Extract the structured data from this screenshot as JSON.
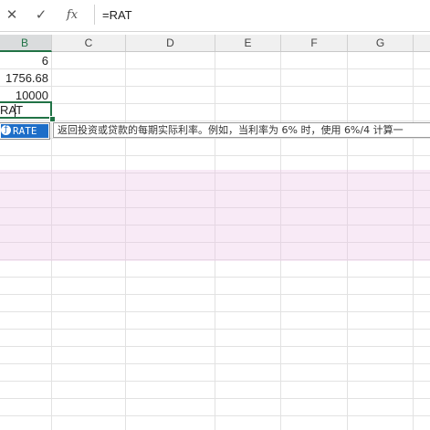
{
  "formula_bar": {
    "cancel_icon": "✕",
    "enter_icon": "✓",
    "fx_label": "fx",
    "formula": "=RAT"
  },
  "columns": [
    "B",
    "C",
    "D",
    "E",
    "F",
    "G"
  ],
  "active_column": "B",
  "cells": {
    "B1": "6",
    "B2": "1756.68",
    "B3": "10000",
    "B4": "RAT"
  },
  "autocomplete": {
    "selected_function": "RATE",
    "icon": "function-icon",
    "tooltip": "返回投资或贷款的每期实际利率。例如，当利率为 6% 时，使用 6%/4 计算一"
  },
  "watermark": {
    "line1": "",
    "line2": ""
  },
  "colors": {
    "accent": "#217346",
    "autocomplete_highlight": "#1e6ec8",
    "band": "#f3dff0"
  }
}
